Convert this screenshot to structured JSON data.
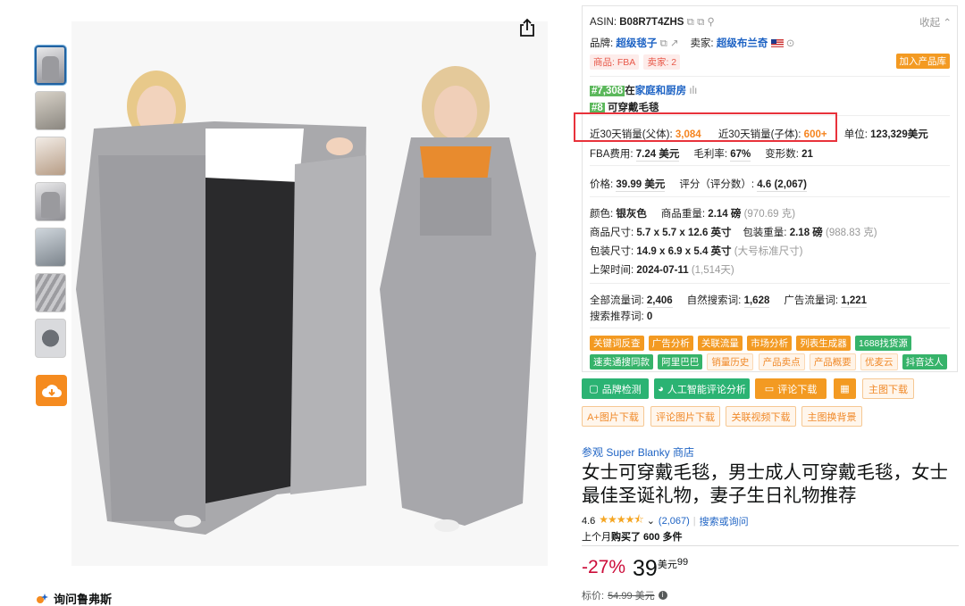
{
  "colors": {
    "accent_orange": "#f58b1f",
    "link_blue": "#1e63c4",
    "highlight_red": "#e8323b",
    "rank_green": "#5cb85c"
  },
  "ask": {
    "label": "询问鲁弗斯"
  },
  "panel": {
    "asin_label": "ASIN:",
    "asin": "B08R7T4ZHS",
    "collapse": "收起",
    "brand_label": "品牌:",
    "brand": "超级毯子",
    "seller_label": "卖家:",
    "seller": "超级布兰奇",
    "tag_fba": "商品: FBA",
    "tag_sellers": "卖家: 2",
    "add_button": "加入产品库",
    "rank1_num": "#7,308",
    "rank1_pre": "在",
    "rank1_cat": "家庭和厨房",
    "rank2_num": "#8",
    "rank2_cat": "可穿戴毛毯",
    "sales_parent_label": "近30天销量(父体):",
    "sales_parent": "3,084",
    "sales_child_label": "近30天销量(子体):",
    "sales_child": "600+",
    "unit_label": "单位:",
    "unit": "123,329美元",
    "fba_label": "FBA费用:",
    "fba": "7.24 美元",
    "margin_label": "毛利率:",
    "margin": "67%",
    "variants_label": "变形数:",
    "variants": "21",
    "price_label": "价格:",
    "price": "39.99 美元",
    "rating_label": "评分（评分数）:",
    "rating": "4.6 (2,067)",
    "color_label": "颜色:",
    "color": "银灰色",
    "weight_label": "商品重量:",
    "weight": "2.14 磅",
    "weight_g": "(970.69 克)",
    "size_label": "商品尺寸:",
    "size": "5.7 x 5.7 x 12.6 英寸",
    "pkg_weight_label": "包装重量:",
    "pkg_weight": "2.18 磅",
    "pkg_weight_g": "(988.83 克)",
    "pkg_size_label": "包装尺寸:",
    "pkg_size": "14.9 x 6.9 x 5.4 英寸",
    "pkg_size_note": "(大号标准尺寸)",
    "date_label": "上架时间:",
    "date": "2024-07-11",
    "date_days": "(1,514天)",
    "traffic_label": "全部流量词:",
    "traffic": "2,406",
    "organic_label": "自然搜索词:",
    "organic": "1,628",
    "ad_label": "广告流量词:",
    "ad": "1,221",
    "rec_label": "搜索推荐词:",
    "rec": "0",
    "tags_row1": [
      "关键词反查",
      "广告分析",
      "关联流量",
      "市场分析",
      "列表生成器",
      "1688找货源"
    ],
    "tags_row2_green": [
      "速卖通搜同款",
      "阿里巴巴"
    ],
    "tags_row2_light": [
      "销量历史",
      "产品卖点",
      "产品概要",
      "优麦云"
    ],
    "tag_row2_last": "抖音达人"
  },
  "actions": {
    "brand_check": "品牌检测",
    "ai_review": "人工智能评论分析",
    "review_download": "评论下载",
    "main_image_download": "主图下载",
    "aplus_download": "A+图片下载",
    "review_images": "评论图片下载",
    "related_video": "关联视频下载",
    "main_bg": "主图换背景"
  },
  "product": {
    "store": "参观 Super Blanky 商店",
    "title": "女士可穿戴毛毯，男士成人可穿戴毛毯，女士最佳圣诞礼物，妻子生日礼物推荐",
    "rating": "4.6",
    "stars": "★★★★⯪",
    "review_count": "(2,067)",
    "search_link": "搜索或询问",
    "bought_prefix": "上个月",
    "bought": "购买了 600 多件",
    "discount": "-27%",
    "price_whole": "39",
    "price_unit": "美元",
    "price_cents": "99",
    "list_label": "标价:",
    "list_price": "54.99 美元"
  }
}
